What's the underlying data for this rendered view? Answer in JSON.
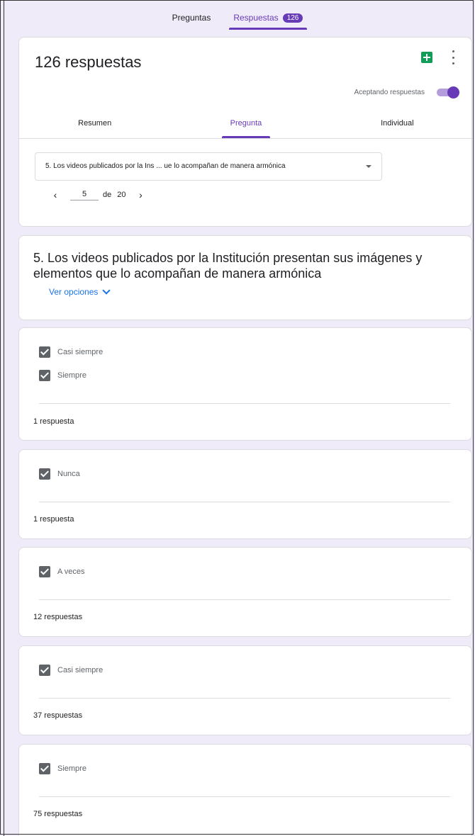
{
  "top_tabs": {
    "questions_label": "Preguntas",
    "responses_label": "Respuestas",
    "responses_badge": "126"
  },
  "header": {
    "title": "126 respuestas",
    "accepting_label": "Aceptando respuestas",
    "accepting_on": true,
    "tabs": [
      {
        "label": "Resumen"
      },
      {
        "label": "Pregunta"
      },
      {
        "label": "Individual"
      }
    ],
    "active_tab": "Pregunta",
    "question_select_value": "5. Los videos publicados por la Ins ... ue lo acompañan de manera armónica",
    "pager": {
      "prev": "‹",
      "current": "5",
      "of": "de",
      "total": "20",
      "next": "›"
    }
  },
  "question": {
    "title": "5. Los videos publicados por la Institución presentan sus imágenes y elementos que lo acompañan de manera armónica",
    "view_options": "Ver opciones"
  },
  "answers": [
    {
      "options": [
        "Casi siempre",
        "Siempre"
      ],
      "count": "1 respuesta"
    },
    {
      "options": [
        "Nunca"
      ],
      "count": "1 respuesta"
    },
    {
      "options": [
        "A veces"
      ],
      "count": "12 respuestas"
    },
    {
      "options": [
        "Casi siempre"
      ],
      "count": "37 respuestas"
    },
    {
      "options": [
        "Siempre"
      ],
      "count": "75 respuestas"
    }
  ],
  "colors": {
    "accent": "#673ab7",
    "link": "#1a73e8",
    "sheets": "#0f9d58",
    "background": "#f0ebf8"
  }
}
